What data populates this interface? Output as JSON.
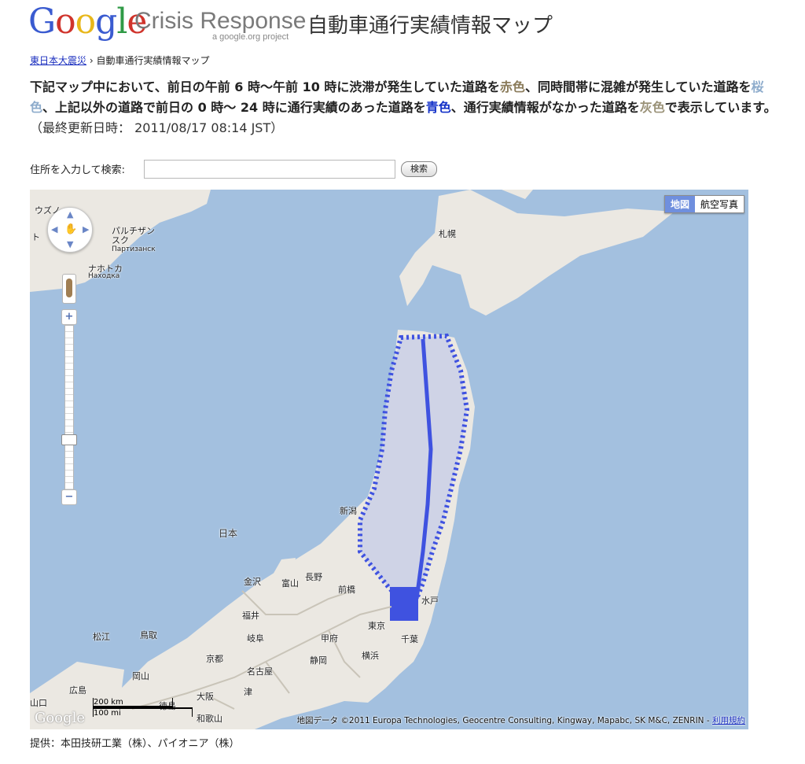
{
  "header": {
    "logo_text": "Google",
    "product": "Crisis Response",
    "subtitle": "a google.org project",
    "title": "自動車通行実績情報マップ"
  },
  "breadcrumb": {
    "parent": "東日本大震災",
    "separator": "›",
    "current": "自動車通行実績情報マップ"
  },
  "description": {
    "p1": "下記マップ中において、前日の午前 6 時〜午前 10 時に渋滞が発生していた道路を",
    "red": "赤色",
    "p2": "、同時間帯に混雑が発生していた道路を",
    "pink": "桜色",
    "p3": "、上記以外の道路で前日の 0 時〜 24 時に通行実績のあった道路を",
    "blue": "青色",
    "p4": "、通行実績情報がなかった道路を",
    "gray": "灰色",
    "p5": "で表示しています。",
    "updated": "（最終更新日時： 2011/08/17 08:14 JST）"
  },
  "search": {
    "label": "住所を入力して検索:",
    "value": "",
    "placeholder": "",
    "button": "検索"
  },
  "map": {
    "type_map": "地図",
    "type_satellite": "航空写真",
    "labels": {
      "sapporo": "札幌",
      "uzno": "ウズノ",
      "parchizan": "パルチザン\nスク",
      "partizansk": "Партизанск",
      "nakhodka_jp": "ナホトカ",
      "nakhodka_ru": "Находка",
      "sea_japan": "日本",
      "niigata": "新潟",
      "kanazawa": "金沢",
      "toyama": "富山",
      "nagano": "長野",
      "maebashi": "前橋",
      "mito": "水戸",
      "fukui": "福井",
      "tokyo": "東京",
      "chiba": "千葉",
      "matsue": "松江",
      "tottori": "鳥取",
      "gifu": "岐阜",
      "kofu": "甲府",
      "kyoto": "京都",
      "shizuoka": "静岡",
      "yokohama": "横浜",
      "okayama": "岡山",
      "nagoya": "名古屋",
      "hiroshima": "広島",
      "tokushima": "徳島",
      "osaka": "大阪",
      "yamaguchi": "山口",
      "wakayama": "和歌山",
      "tsu": "津",
      "tsuru": "ト"
    },
    "scale_km": "200 km",
    "scale_mi": "100 mi",
    "copyright": "地図データ ©2011 Europa Technologies, Geocentre Consulting, Kingway, Mapabc, SK M&C, ZENRIN -",
    "terms_link": "利用規約",
    "watermark": "Google"
  },
  "footer": {
    "credit": "提供：本田技研工業（株）、パイオニア（株）"
  },
  "colors": {
    "sea": "#a3c0df",
    "land": "#ebe8e2",
    "road_blue": "#3f52e0",
    "link": "#1a2ebf"
  }
}
